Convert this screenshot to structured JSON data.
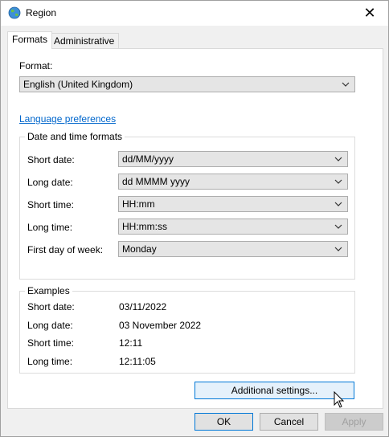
{
  "window": {
    "title": "Region",
    "close_glyph": "✕"
  },
  "tabs": [
    {
      "label": "Formats",
      "active": true
    },
    {
      "label": "Administrative",
      "active": false
    }
  ],
  "format": {
    "label": "Format:",
    "value": "English (United Kingdom)"
  },
  "language_link": "Language preferences",
  "datetime": {
    "title": "Date and time formats",
    "rows": [
      {
        "label": "Short date:",
        "value": "dd/MM/yyyy"
      },
      {
        "label": "Long date:",
        "value": "dd MMMM yyyy"
      },
      {
        "label": "Short time:",
        "value": "HH:mm"
      },
      {
        "label": "Long time:",
        "value": "HH:mm:ss"
      },
      {
        "label": "First day of week:",
        "value": "Monday"
      }
    ]
  },
  "examples": {
    "title": "Examples",
    "rows": [
      {
        "label": "Short date:",
        "value": "03/11/2022"
      },
      {
        "label": "Long date:",
        "value": "03 November 2022"
      },
      {
        "label": "Short time:",
        "value": "12:11"
      },
      {
        "label": "Long time:",
        "value": "12:11:05"
      }
    ]
  },
  "buttons": {
    "additional": "Additional settings...",
    "ok": "OK",
    "cancel": "Cancel",
    "apply": "Apply"
  },
  "icons": {
    "window": "globe-icon",
    "close": "close-icon",
    "dropdown": "chevron-down-icon",
    "cursor": "mouse-pointer-icon"
  }
}
